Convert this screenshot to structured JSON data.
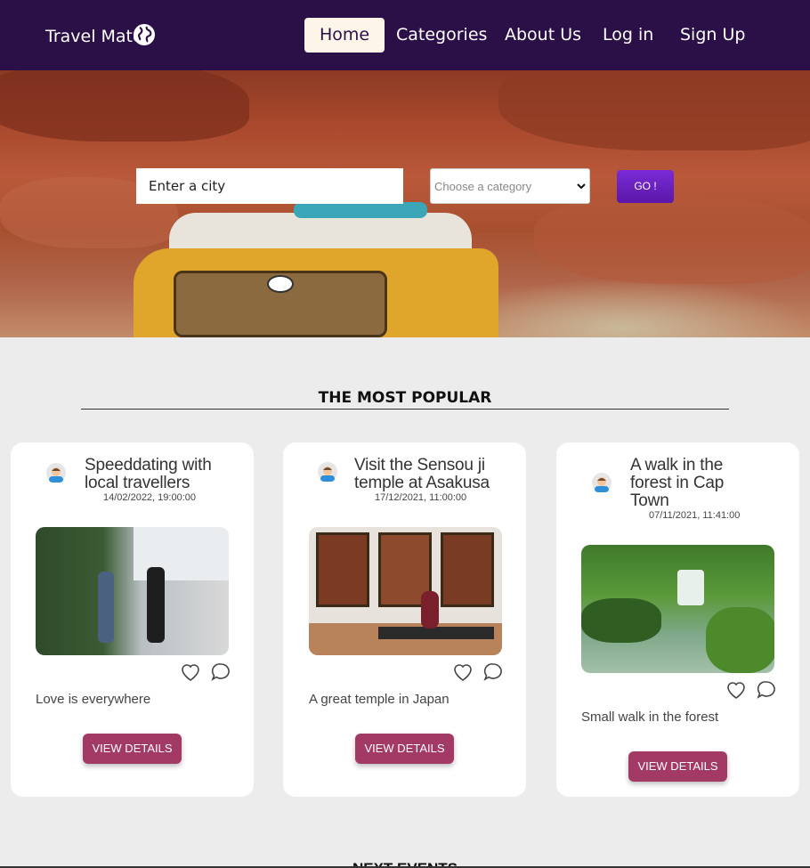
{
  "nav": {
    "brand": "Travel Mate",
    "brand_icon": "globe-icon",
    "items": [
      {
        "label": "Home",
        "active": true
      },
      {
        "label": "Categories",
        "active": false
      },
      {
        "label": "About Us",
        "active": false
      },
      {
        "label": "Log in",
        "active": false
      },
      {
        "label": "Sign Up",
        "active": false
      }
    ]
  },
  "search": {
    "city_value": "Enter a city",
    "category_value": "Choose a category",
    "go_label": "GO !"
  },
  "popular": {
    "title": "THE MOST POPULAR",
    "cards": [
      {
        "title": "Speeddating with local travellers",
        "date": "14/02/2022, 19:00:00",
        "image": "couple-walking",
        "description": "Love is everywhere",
        "button": "VIEW DETAILS"
      },
      {
        "title": "Visit the Sensou ji temple at Asakusa",
        "date": "17/12/2021, 11:00:00",
        "image": "museum-paintings",
        "description": "A great temple in Japan",
        "button": "VIEW DETAILS"
      },
      {
        "title": "A walk in the forest in Cap Town",
        "date": "07/11/2021, 11:41:00",
        "image": "forest-waterfall",
        "description": "Small walk in the forest",
        "button": "VIEW DETAILS"
      }
    ]
  },
  "next": {
    "title": "NEXT EVENTS"
  },
  "colors": {
    "nav_bg": "#2b0f47",
    "accent_button": "#a33a65",
    "go_button": "#6a1fc0"
  }
}
